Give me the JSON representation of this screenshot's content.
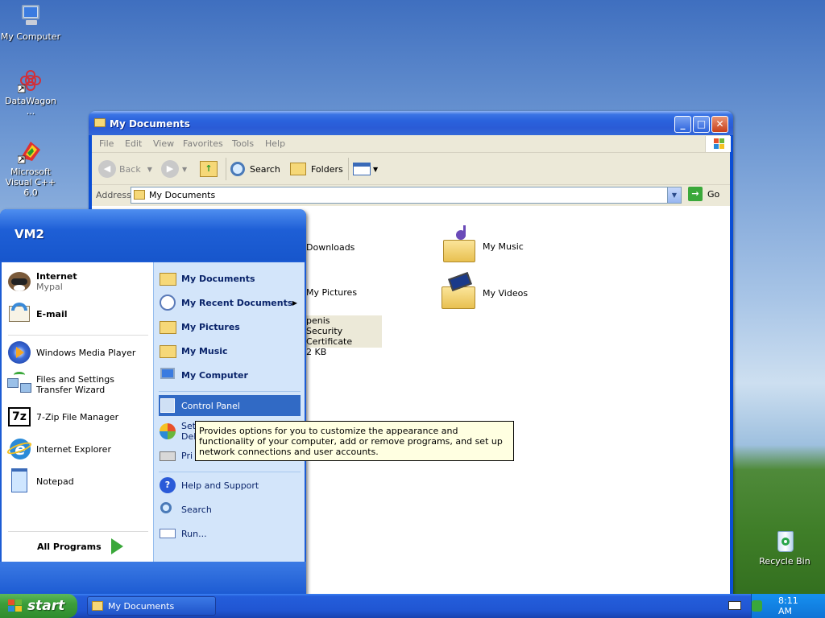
{
  "desktop": {
    "icons": [
      {
        "label": "My Computer"
      },
      {
        "label": "DataWagon ..."
      },
      {
        "label": "Microsoft Visual C++ 6.0"
      },
      {
        "label": "Recycle Bin"
      }
    ]
  },
  "window": {
    "title": "My Documents",
    "menu": [
      "File",
      "Edit",
      "View",
      "Favorites",
      "Tools",
      "Help"
    ],
    "toolbar": {
      "back": "Back",
      "search": "Search",
      "folders": "Folders"
    },
    "address": {
      "label": "Address",
      "value": "My Documents",
      "go": "Go"
    },
    "items": [
      {
        "name": "Downloads"
      },
      {
        "name": "My Music"
      },
      {
        "name": "My Pictures"
      },
      {
        "name": "My Videos"
      },
      {
        "name": "penis",
        "type": "Security Certificate",
        "size": "2 KB"
      }
    ]
  },
  "start_menu": {
    "user": "VM2",
    "pinned": [
      {
        "title": "Internet",
        "subtitle": "Mypal"
      },
      {
        "title": "E-mail"
      }
    ],
    "recent": [
      {
        "title": "Windows Media Player"
      },
      {
        "title": "Files and Settings Transfer Wizard"
      },
      {
        "title": "7-Zip File Manager"
      },
      {
        "title": "Internet Explorer"
      },
      {
        "title": "Notepad"
      }
    ],
    "all_programs": "All Programs",
    "right": [
      "My Documents",
      "My Recent Documents",
      "My Pictures",
      "My Music",
      "My Computer",
      "Control Panel",
      "Set",
      "Del",
      "Pri",
      "Help and Support",
      "Search",
      "Run..."
    ],
    "tooltip": "Provides options for you to customize the appearance and functionality of your computer, add or remove programs, and set up network connections and user accounts."
  },
  "taskbar": {
    "start": "start",
    "task": "My Documents",
    "clock": "8:11 AM"
  }
}
